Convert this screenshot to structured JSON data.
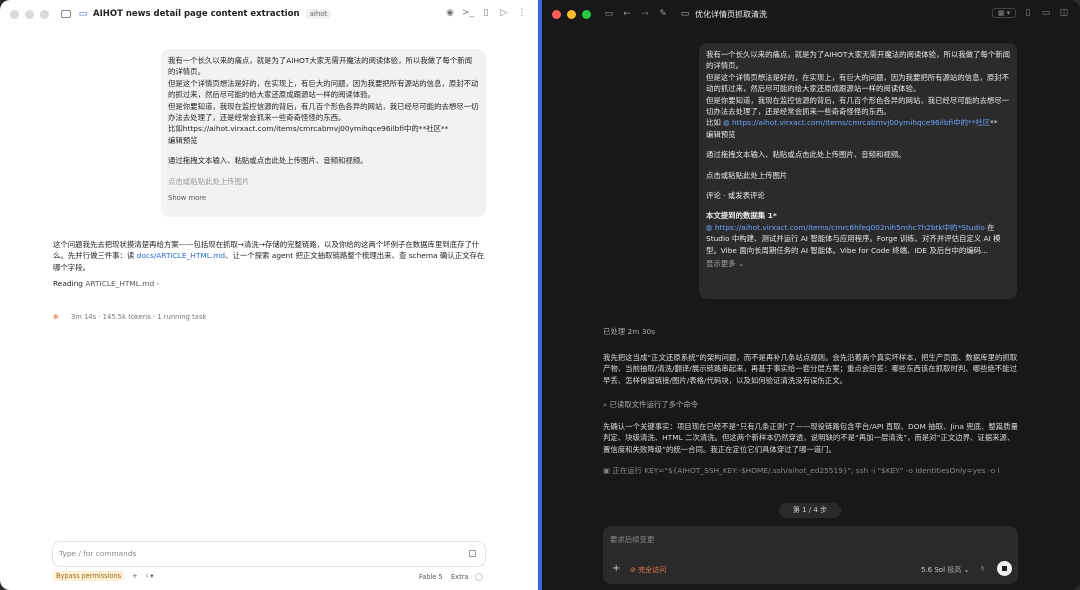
{
  "left": {
    "title": "AIHOT news detail page content extraction",
    "tag": "aihot",
    "bubble": {
      "l1": "我有一个长久以来的痛点，就是为了AIHOT大家无需开魔法的阅读体验，所以我做了每个新闻的详情页。",
      "l2": "但是这个详情页想法是好的，在实现上，有巨大的问题，因为我要把所有源站的信息，原封不动的抓过来，然后尽可能的给大家还原成跟源站一样的阅读体验。",
      "l3": "但是你要知道，我现在监控信源的背后，有几百个形色各异的网站，我已经尽可能的去想尽一切办法去处理了，还是经常会抓来一些奇奇怪怪的东西。",
      "l4": "比如https://aihot.virxact.com/items/cmrcabmvj00ymihqce96ilbfi中的**社区**",
      "l5": "编辑预览",
      "l6": "通过拖拽文本输入、粘贴或点击此处上传图片、音频和视频。",
      "l7": "点击或粘贴此处上传图片",
      "show_more": "Show more"
    },
    "reply_a": "这个问题我先去把现状摸清楚再给方案——包括现在抓取→清洗→存储的完整链路，以及你给的这两个坏例子在数据库里到底存了什么。先并行做三件事：读",
    "reply_link": "docs/ARTICLE_HTML.md",
    "reply_b": "、让一个探索 agent 把正文抽取链路整个梳理出来、查 schema 确认正文存在哪个字段。",
    "reading_label": "Reading",
    "reading_file": "ARTICLE_HTML.md",
    "status": "3m 14s · 145.5k tokens · 1 running task",
    "composer_placeholder": "Type / for commands",
    "bypass": "Bypass permissions",
    "model": "Fable 5",
    "effort": "Extra"
  },
  "right": {
    "title": "优化详情页抓取清洗",
    "bubble": {
      "l1": "我有一个长久以来的痛点，就是为了AIHOT大家无需开魔法的阅读体验，所以我做了每个新闻的详情页。",
      "l2": "但是这个详情页想法是好的，在实现上，有巨大的问题，因为我要把所有源站的信息，原封不动的抓过来，然后尽可能的给大家还原成跟源站一样的阅读体验。",
      "l3": "但是你要知道，我现在监控信源的背后，有几百个形色各异的网站，我已经尽可能的去想尽一切办法去处理了，还是经常会抓来一些奇奇怪怪的东西。",
      "l4a": "比如",
      "l4link": "https://aihot.virxact.com/items/cmrcabmvj00ymihqce96ilbfi中的**社区",
      "l4b": "**",
      "l5": "编辑预览",
      "l6": "通过拖拽文本输入、粘贴或点击此处上传图片、音频和视频。",
      "l7": "点击或粘贴此处上传图片",
      "l8": "评论 · 或发表评论",
      "l9": "本文提到的数据集 1*",
      "l10link": "https://aihot.virxact.com/items/cmrc6hfeq002nih5mhc7h2btk中的*Studio",
      "l10b": " 在 Studio 中构建、测试并运行 AI 智能体与应用程序。Forge 训练、对齐并评估自定义 AI 模型。Vibe 面向长周期任务的 AI 智能体。Vibe for Code 终端、IDE 及后台中的编码...",
      "show_more": "显示更多"
    },
    "processed": "已处理 2m 30s",
    "p1": "我先把这当成“正文还原系统”的架构问题，而不是再补几条站点规则。会先沿着两个真实坏样本，把生产页面、数据库里的抓取产物、当前抽取/清洗/翻译/展示链路串起来，再基于事实给一套分层方案；重点会回答：哪些东西该在抓取时判、哪些绝不能过早丢、怎样保留链接/图片/表格/代码块，以及如何验证清洗没有误伤正文。",
    "read_files": "已读取文件运行了多个命令",
    "p2": "先确认一个关键事实：项目现在已经不是“只有几条正则”了——现役链路包含平台/API 直取、DOM 抽取、Jina 兜底、整篇质量判定、块级清洗、HTML 二次清洗。但这两个新样本仍然穿透，说明缺的不是“再加一层清洗”，而是对“正文边界、证据来源、置信度和失败降级”的统一合同。我正在定位它们具体穿过了哪一道门。",
    "running": "正在运行 KEY=\"${AIHOT_SSH_KEY:-$HOME/.ssh/aihot_ed25519}\"; ssh -i \"$KEY\" -o IdentitiesOnly=yes -o I",
    "step": "第 1 / 4 步",
    "composer_placeholder": "要求后续变更",
    "access": "完全访问",
    "model": "5.6 Sol",
    "effort": "极高"
  }
}
